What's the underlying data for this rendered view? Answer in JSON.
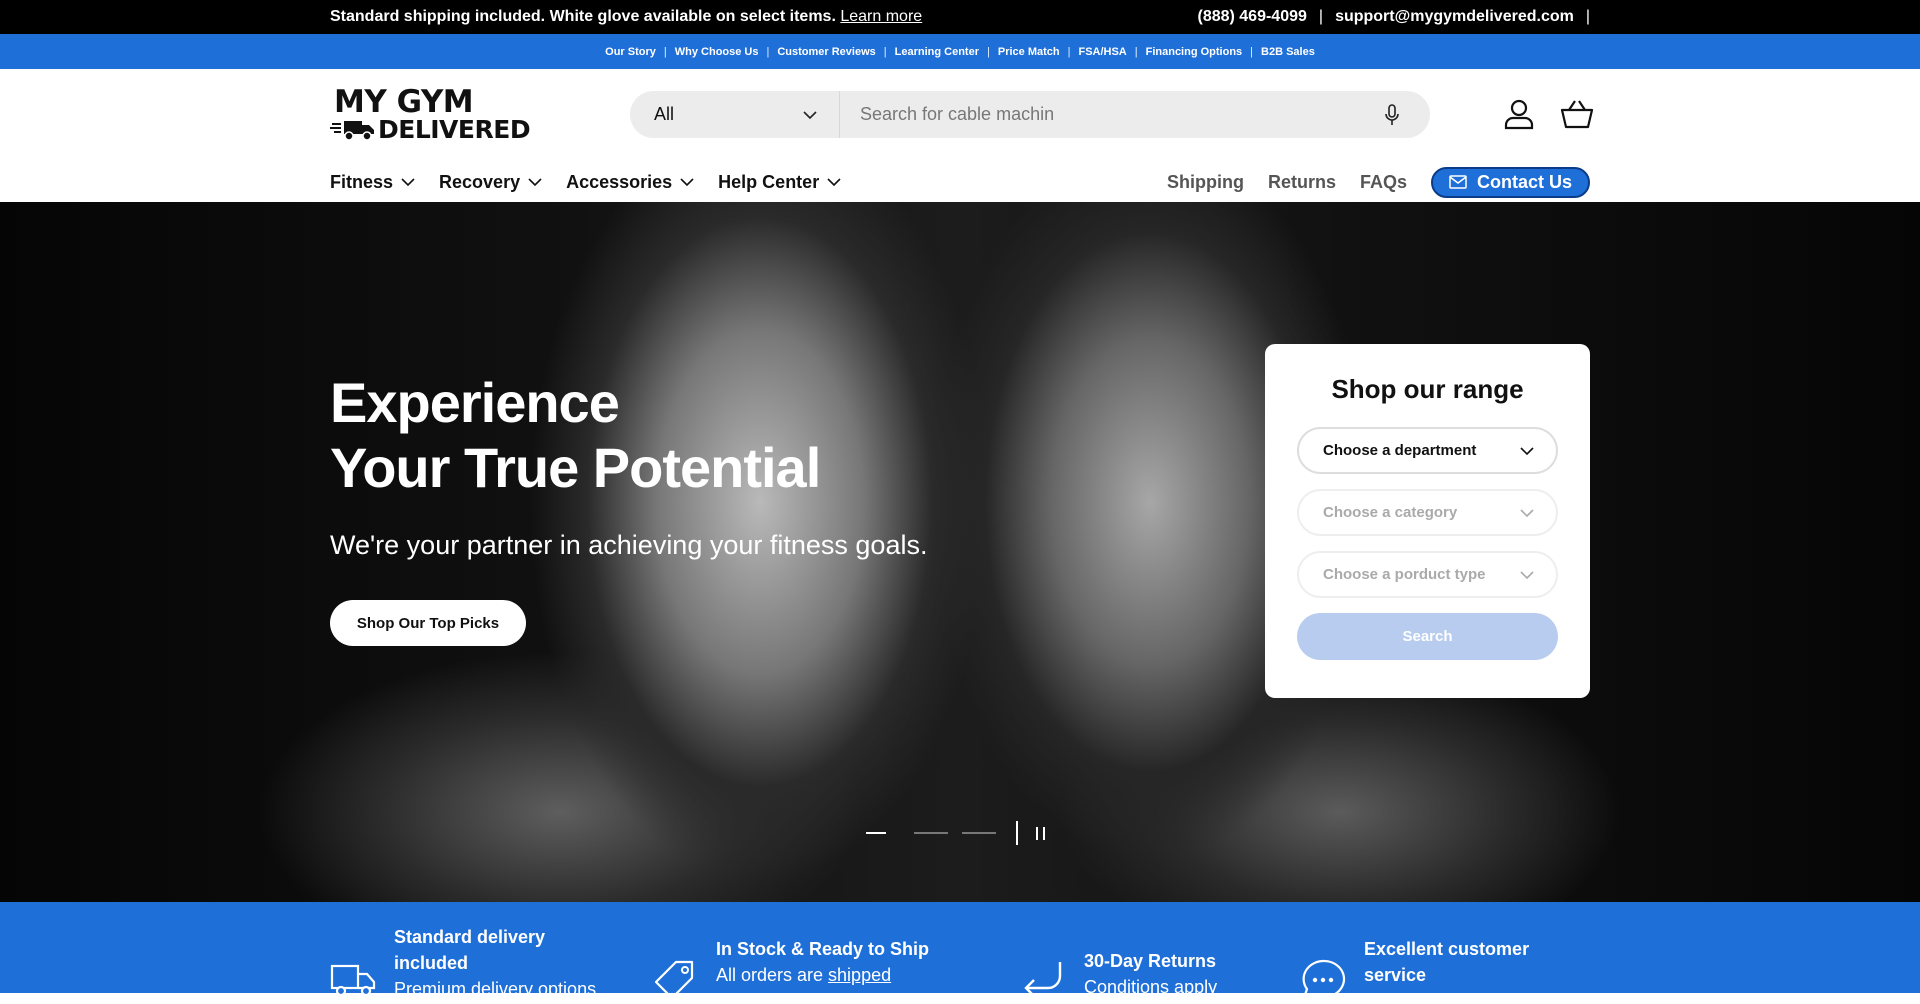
{
  "announcement": {
    "text": "Standard shipping included. White glove available on select items.",
    "link": "Learn more",
    "phone": "(888) 469-4099",
    "email": "support@mygymdelivered.com"
  },
  "top_links": [
    "Our Story",
    "Why Choose Us",
    "Customer Reviews",
    "Learning Center",
    "Price Match",
    "FSA/HSA",
    "Financing Options",
    "B2B Sales"
  ],
  "logo": {
    "line1": "MY GYM",
    "line2": "DELIVERED"
  },
  "search": {
    "department": "All",
    "placeholder": "Search for cable machin"
  },
  "nav": {
    "menu": [
      "Fitness",
      "Recovery",
      "Accessories",
      "Help Center"
    ],
    "links": [
      "Shipping",
      "Returns",
      "FAQs"
    ],
    "contact": "Contact Us"
  },
  "hero": {
    "heading_line1": "Experience",
    "heading_line2": "Your True Potential",
    "subheading": "We're your partner in achieving your fitness goals.",
    "cta": "Shop Our Top Picks",
    "slides_total": 3,
    "active_slide": 1
  },
  "shop_panel": {
    "title": "Shop our range",
    "department": "Choose a department",
    "category": "Choose a category",
    "product_type": "Choose a porduct type",
    "search_button": "Search"
  },
  "features": [
    {
      "title": "Standard delivery included",
      "subtitle": "Premium delivery options",
      "icon": "truck-icon"
    },
    {
      "title": "In Stock & Ready to Ship",
      "subtitle_prefix": "All orders are ",
      "subtitle_link": "shipped",
      "icon": "tag-icon"
    },
    {
      "title": "30-Day Returns",
      "subtitle": "Conditions apply",
      "icon": "return-arrow-icon"
    },
    {
      "title": "Excellent customer service",
      "subtitle": "",
      "icon": "chat-bubble-icon"
    }
  ],
  "colors": {
    "brand_blue": "#1f6fd8",
    "announcement_bg": "#000000",
    "search_bg": "#ececec"
  }
}
